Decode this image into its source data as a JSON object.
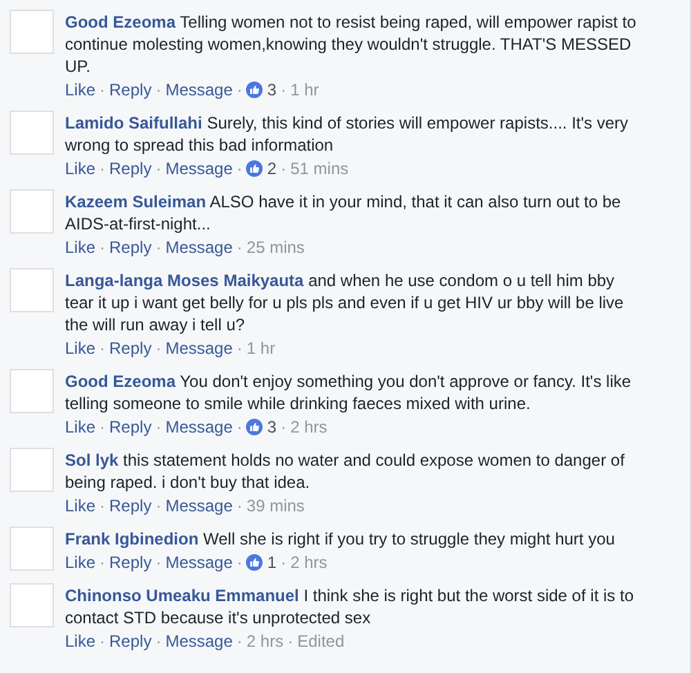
{
  "separator": "·",
  "comments": [
    {
      "author": "Good Ezeoma",
      "text": "Telling women not to resist being raped, will empower rapist to continue molesting women,knowing they wouldn't struggle. THAT'S MESSED UP.",
      "actions": [
        "Like",
        "Reply",
        "Message"
      ],
      "likes": "3",
      "time": "1 hr"
    },
    {
      "author": "Lamido Saifullahi",
      "text": "Surely, this kind of stories will empower rapists.... It's very wrong to spread this bad information",
      "actions": [
        "Like",
        "Reply",
        "Message"
      ],
      "likes": "2",
      "time": "51 mins"
    },
    {
      "author": "Kazeem Suleiman",
      "text": "ALSO have it in your mind, that it can also turn out to be AIDS-at-first-night...",
      "actions": [
        "Like",
        "Reply",
        "Message"
      ],
      "time": "25 mins"
    },
    {
      "author": "Langa-langa Moses Maikyauta",
      "text": "and when he use condom o u tell him bby tear it up i want get belly for u pls pls and even if u get HIV ur bby will be live the will run away i tell u?",
      "actions": [
        "Like",
        "Reply",
        "Message"
      ],
      "time": "1 hr"
    },
    {
      "author": "Good Ezeoma",
      "text": "You don't enjoy something you don't approve or fancy. It's like telling someone to smile while drinking faeces mixed with urine.",
      "actions": [
        "Like",
        "Reply",
        "Message"
      ],
      "likes": "3",
      "time": "2 hrs"
    },
    {
      "author": "Sol lyk",
      "text": "this statement holds no water and could expose women to danger of being raped. i don't buy that idea.",
      "actions": [
        "Like",
        "Reply",
        "Message"
      ],
      "time": "39 mins"
    },
    {
      "author": "Frank Igbinedion",
      "text": "Well she is right if you try to struggle they might hurt you",
      "actions": [
        "Like",
        "Reply",
        "Message"
      ],
      "likes": "1",
      "time": "2 hrs"
    },
    {
      "author": "Chinonso Umeaku Emmanuel",
      "text": "I think she is right but the worst side of it is to contact STD because it's unprotected sex",
      "actions": [
        "Like",
        "Reply",
        "Message"
      ],
      "time": "2 hrs",
      "edited": "Edited"
    }
  ]
}
